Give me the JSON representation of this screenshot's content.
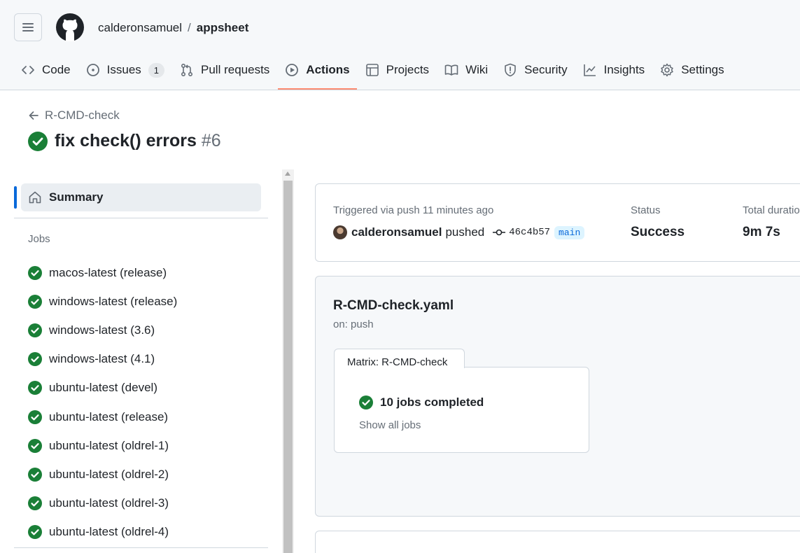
{
  "header": {
    "owner": "calderonsamuel",
    "separator": "/",
    "repo": "appsheet"
  },
  "tabs": [
    {
      "label": "Code",
      "icon": "code-icon"
    },
    {
      "label": "Issues",
      "icon": "issue-icon",
      "count": "1"
    },
    {
      "label": "Pull requests",
      "icon": "pull-request-icon"
    },
    {
      "label": "Actions",
      "icon": "play-icon",
      "active": true
    },
    {
      "label": "Projects",
      "icon": "table-icon"
    },
    {
      "label": "Wiki",
      "icon": "book-icon"
    },
    {
      "label": "Security",
      "icon": "shield-icon"
    },
    {
      "label": "Insights",
      "icon": "graph-icon"
    },
    {
      "label": "Settings",
      "icon": "gear-icon"
    }
  ],
  "run": {
    "back_label": "R-CMD-check",
    "title": "fix check() errors",
    "number": "#6"
  },
  "sidebar": {
    "summary_label": "Summary",
    "jobs_heading": "Jobs",
    "jobs": [
      "macos-latest (release)",
      "windows-latest (release)",
      "windows-latest (3.6)",
      "windows-latest (4.1)",
      "ubuntu-latest (devel)",
      "ubuntu-latest (release)",
      "ubuntu-latest (oldrel-1)",
      "ubuntu-latest (oldrel-2)",
      "ubuntu-latest (oldrel-3)",
      "ubuntu-latest (oldrel-4)"
    ]
  },
  "summary": {
    "trigger": "Triggered via push 11 minutes ago",
    "actor": "calderonsamuel",
    "action": "pushed",
    "commit": "46c4b57",
    "branch": "main",
    "status_label": "Status",
    "status_value": "Success",
    "duration_label": "Total duration",
    "duration_value": "9m 7s"
  },
  "workflow": {
    "file": "R-CMD-check.yaml",
    "trigger": "on: push",
    "matrix_label": "Matrix: R-CMD-check",
    "jobs_completed": "10 jobs completed",
    "show_all": "Show all jobs"
  },
  "colors": {
    "success": "#1a7f37",
    "accent": "#0969da",
    "tab_underline": "#fd8c73"
  }
}
